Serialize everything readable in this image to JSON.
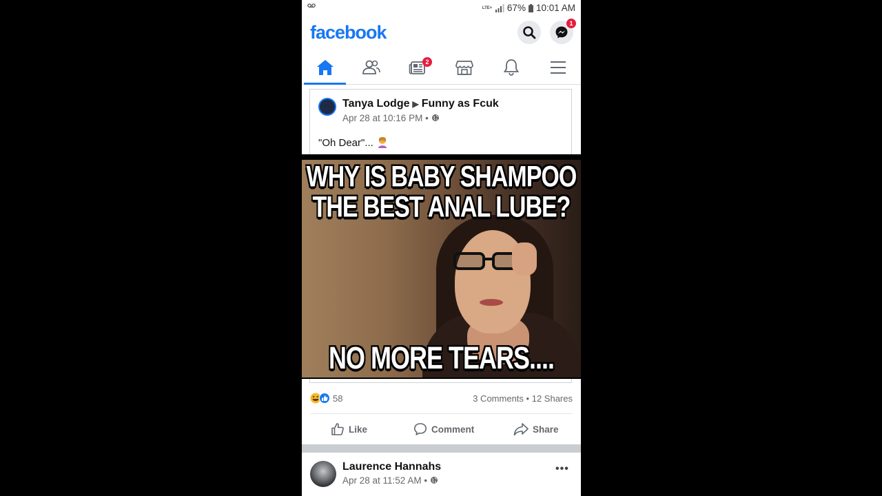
{
  "status_bar": {
    "network": "LTE+",
    "battery": "67%",
    "time": "10:01 AM"
  },
  "header": {
    "logo": "facebook",
    "messenger_badge": "1"
  },
  "tabs": [
    {
      "name": "home",
      "active": true
    },
    {
      "name": "friends"
    },
    {
      "name": "news",
      "badge": "2"
    },
    {
      "name": "marketplace"
    },
    {
      "name": "notifications"
    },
    {
      "name": "menu"
    }
  ],
  "post": {
    "author": "Tanya Lodge",
    "group": "Funny as Fcuk",
    "timestamp": "Apr 28 at 10:16 PM",
    "separator": "•",
    "text": "\"Oh Dear\"...",
    "meme": {
      "line1": "WHY IS BABY SHAMPOO",
      "line2": "THE BEST ANAL LUBE?",
      "line3": "NO MORE TEARS...."
    },
    "reaction_count": "58",
    "comments": "3 Comments",
    "shares": "12 Shares",
    "dot": "•",
    "actions": {
      "like": "Like",
      "comment": "Comment",
      "share": "Share"
    }
  },
  "next_post": {
    "author": "Laurence Hannahs",
    "timestamp": "Apr 28 at 11:52 AM",
    "separator": "•",
    "more": "•••"
  },
  "colors": {
    "brand": "#1877f2",
    "badge": "#e41e3f",
    "muted_text": "#65676b"
  }
}
